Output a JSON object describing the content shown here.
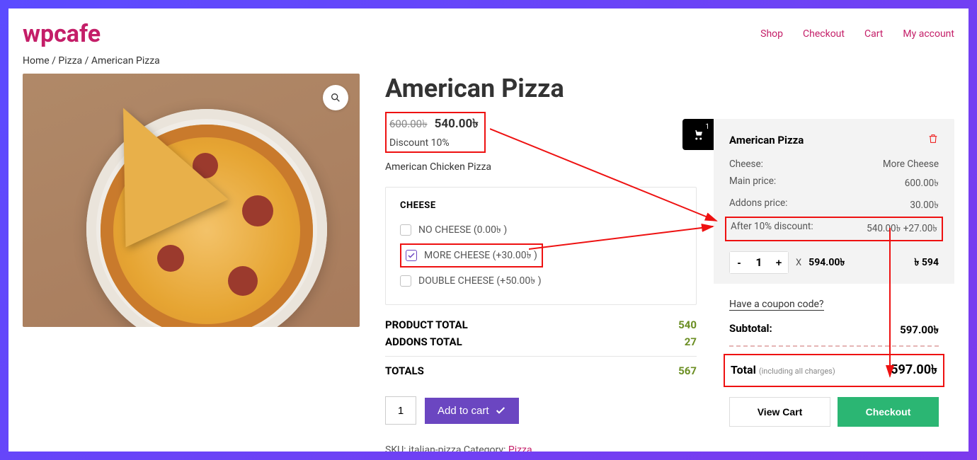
{
  "header": {
    "logo": "wpcafe",
    "menu": {
      "shop": "Shop",
      "checkout": "Checkout",
      "cart": "Cart",
      "account": "My account"
    }
  },
  "breadcrumb": {
    "home": "Home",
    "sep1": " / ",
    "cat": "Pizza",
    "sep2": " / ",
    "current": "American Pizza"
  },
  "product": {
    "title": "American Pizza",
    "old_price": "600.00৳",
    "new_price": "540.00৳",
    "discount_text": "Discount 10%",
    "desc": "American Chicken Pizza",
    "addon_group_title": "CHEESE",
    "addons": {
      "none": "NO CHEESE (0.00৳ )",
      "more": "MORE CHEESE (+30.00৳ )",
      "double": "DOUBLE CHEESE (+50.00৳ )"
    },
    "totals": {
      "product_label": "PRODUCT TOTAL",
      "product_value": "540",
      "addons_label": "ADDONS TOTAL",
      "addons_value": "27",
      "grand_label": "TOTALS",
      "grand_value": "567"
    },
    "qty": "1",
    "add_label": "Add to cart",
    "meta": {
      "sku_label": "SKU: ",
      "sku": "italian-pizza",
      "cat_label": " Category: ",
      "cat": "Pizza"
    }
  },
  "minicart": {
    "badge": "1",
    "item_title": "American Pizza",
    "rows": {
      "cheese_k": "Cheese:",
      "cheese_v": "More Cheese",
      "main_k": "Main price:",
      "main_v": "600.00৳",
      "addon_k": "Addons price:",
      "addon_v": "30.00৳",
      "after_k": "After 10% discount:",
      "after_v": "540.00৳ +27.00৳"
    },
    "qty": "1",
    "x": "X",
    "line_price": "594.00৳",
    "line_total_sym": "৳",
    "line_total": "594",
    "coupon": "Have a coupon code?",
    "subtotal_label": "Subtotal:",
    "subtotal_value": "597.00৳",
    "total_label": "Total",
    "total_sub": "(including all charges)",
    "total_value": "597.00৳",
    "view_cart": "View Cart",
    "checkout": "Checkout"
  }
}
